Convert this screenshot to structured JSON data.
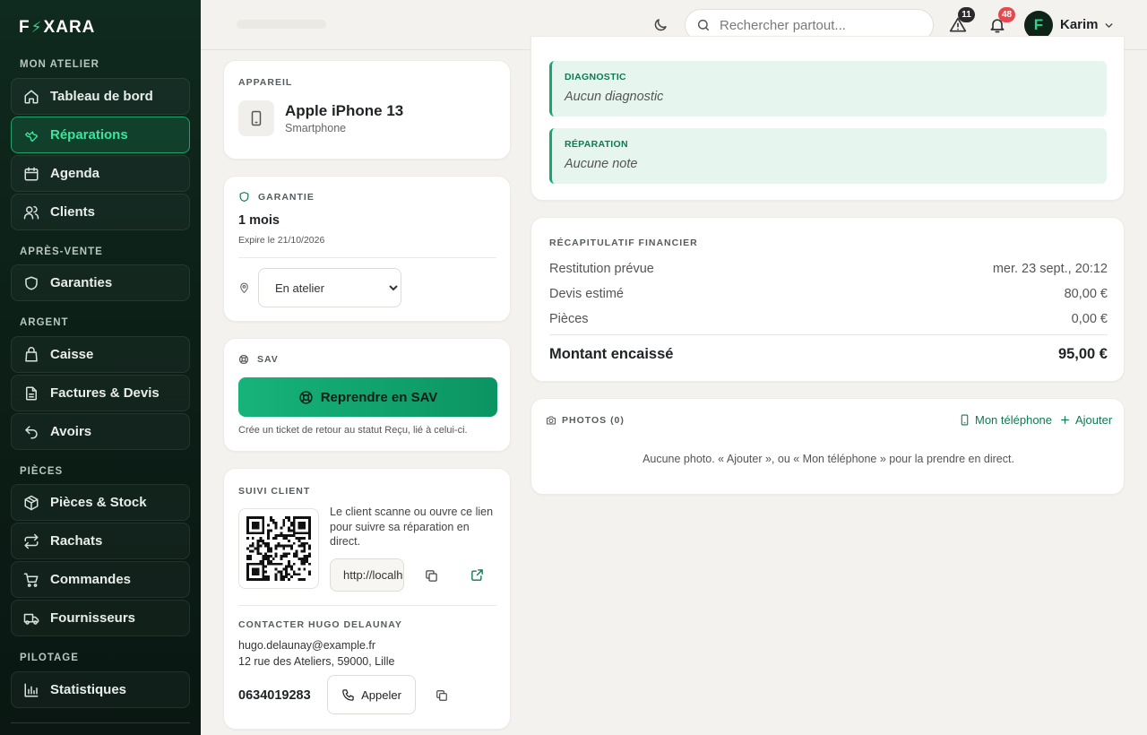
{
  "brand": {
    "prefix": "F",
    "bolt": "⚡",
    "suffix": "XARA"
  },
  "sidebar": {
    "sections": [
      {
        "title": "MON ATELIER"
      },
      {
        "title": "APRÈS-VENTE"
      },
      {
        "title": "ARGENT"
      },
      {
        "title": "PIÈCES"
      },
      {
        "title": "PILOTAGE"
      }
    ],
    "items": [
      {
        "label": "Tableau de bord",
        "icon": "home-icon"
      },
      {
        "label": "Réparations",
        "icon": "wrench-icon",
        "active": true
      },
      {
        "label": "Agenda",
        "icon": "calendar-icon"
      },
      {
        "label": "Clients",
        "icon": "users-icon"
      },
      {
        "label": "Garanties",
        "icon": "shield-icon"
      },
      {
        "label": "Caisse",
        "icon": "cash-register-icon"
      },
      {
        "label": "Factures & Devis",
        "icon": "file-icon"
      },
      {
        "label": "Avoirs",
        "icon": "undo-icon"
      },
      {
        "label": "Pièces & Stock",
        "icon": "package-icon"
      },
      {
        "label": "Rachats",
        "icon": "swap-icon"
      },
      {
        "label": "Commandes",
        "icon": "cart-icon"
      },
      {
        "label": "Fournisseurs",
        "icon": "truck-icon"
      },
      {
        "label": "Statistiques",
        "icon": "bar-chart-icon"
      }
    ]
  },
  "header": {
    "search_placeholder": "Rechercher partout...",
    "warnings_count": "11",
    "notifications_count": "48",
    "user_initial": "F",
    "user_name": "Karim"
  },
  "device": {
    "label": "APPAREIL",
    "name": "Apple iPhone 13",
    "type": "Smartphone"
  },
  "warranty": {
    "label": "GARANTIE",
    "duration": "1 mois",
    "expires": "Expire le 21/10/2026",
    "location": "En atelier"
  },
  "sav": {
    "label": "SAV",
    "button": "Reprendre en SAV",
    "help": "Crée un ticket de retour au statut Reçu, lié à celui-ci."
  },
  "tracking": {
    "label": "SUIVI CLIENT",
    "description": "Le client scanne ou ouvre ce lien pour suivre sa réparation en direct.",
    "url": "http://localhost"
  },
  "contact": {
    "label": "CONTACTER HUGO DELAUNAY",
    "email": "hugo.delaunay@example.fr",
    "address": "12 rue des Ateliers, 59000, Lille",
    "phone": "0634019283",
    "call_label": "Appeler"
  },
  "notes": {
    "diagnostic_title": "DIAGNOSTIC",
    "diagnostic_value": "Aucun diagnostic",
    "repair_title": "RÉPARATION",
    "repair_value": "Aucune note"
  },
  "finance": {
    "label": "RÉCAPITULATIF FINANCIER",
    "rows": [
      {
        "label": "Restitution prévue",
        "value": "mer. 23 sept., 20:12"
      },
      {
        "label": "Devis estimé",
        "value": "80,00 €"
      },
      {
        "label": "Pièces",
        "value": "0,00 €"
      }
    ],
    "total_label": "Montant encaissé",
    "total_value": "95,00 €"
  },
  "photos": {
    "label": "PHOTOS (0)",
    "phone_link": "Mon téléphone",
    "add_link": "Ajouter",
    "empty": "Aucune photo. « Ajouter », ou « Mon téléphone » pour la prendre en direct."
  },
  "colors": {
    "accent": "#17a673",
    "sidebar_bg": "#0f2a1f",
    "warning_badge": "#2b2b2b",
    "notif_badge": "#e5484d"
  }
}
